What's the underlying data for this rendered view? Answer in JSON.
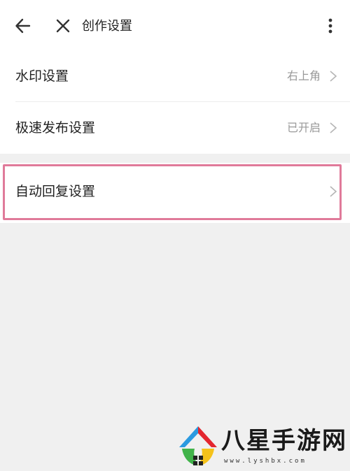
{
  "header": {
    "title": "创作设置",
    "icons": {
      "back": "arrow-left-icon",
      "close": "close-icon",
      "more": "more-vertical-icon"
    }
  },
  "settings": [
    {
      "label": "水印设置",
      "value": "右上角"
    },
    {
      "label": "极速发布设置",
      "value": "已开启"
    },
    {
      "label": "自动回复设置",
      "value": ""
    }
  ],
  "highlight": {
    "color": "#e07a9a"
  },
  "watermark": {
    "title": "八星手游网",
    "url": "www.lyshbx.com"
  },
  "colors": {
    "background": "#f0f0f0",
    "row_text": "#222222",
    "secondary_text": "#999999"
  }
}
